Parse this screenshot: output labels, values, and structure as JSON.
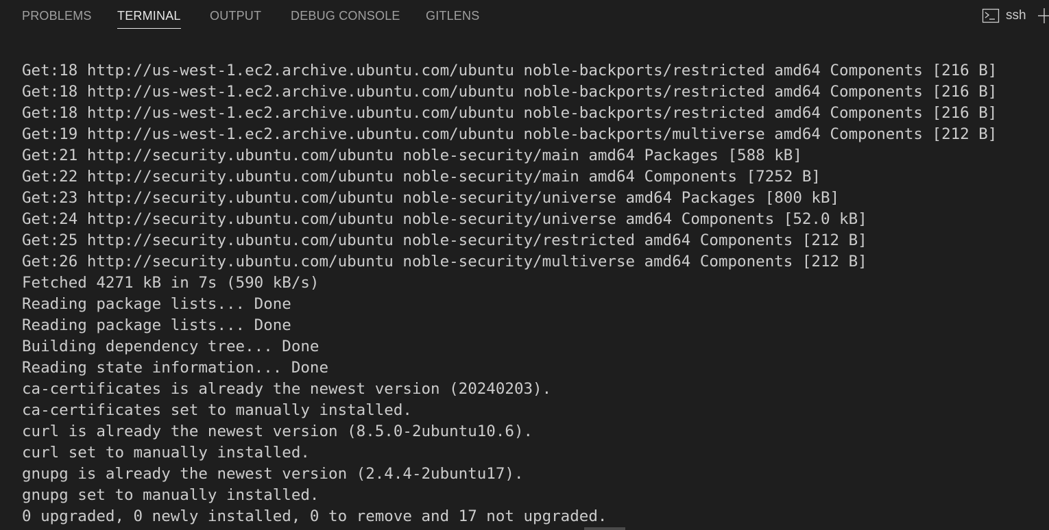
{
  "tabs": [
    {
      "label": "PROBLEMS",
      "active": false
    },
    {
      "label": "TERMINAL",
      "active": true
    },
    {
      "label": "OUTPUT",
      "active": false
    },
    {
      "label": "DEBUG CONSOLE",
      "active": false
    },
    {
      "label": "GITLENS",
      "active": false
    }
  ],
  "terminal_selector": {
    "icon": "terminal-icon",
    "label": "ssh"
  },
  "add_terminal": {
    "icon": "plus-icon"
  },
  "colors": {
    "background": "#1e1e1e",
    "text": "#cccccc",
    "active_tab": "#e7e7e7",
    "inactive_tab": "#a0a0a0"
  },
  "terminal": {
    "lines": [
      "Get:18 http://us-west-1.ec2.archive.ubuntu.com/ubuntu noble-backports/restricted amd64 Components [216 B]",
      "Get:18 http://us-west-1.ec2.archive.ubuntu.com/ubuntu noble-backports/restricted amd64 Components [216 B]",
      "Get:18 http://us-west-1.ec2.archive.ubuntu.com/ubuntu noble-backports/restricted amd64 Components [216 B]",
      "Get:19 http://us-west-1.ec2.archive.ubuntu.com/ubuntu noble-backports/multiverse amd64 Components [212 B]",
      "Get:21 http://security.ubuntu.com/ubuntu noble-security/main amd64 Packages [588 kB]",
      "Get:22 http://security.ubuntu.com/ubuntu noble-security/main amd64 Components [7252 B]",
      "Get:23 http://security.ubuntu.com/ubuntu noble-security/universe amd64 Packages [800 kB]",
      "Get:24 http://security.ubuntu.com/ubuntu noble-security/universe amd64 Components [52.0 kB]",
      "Get:25 http://security.ubuntu.com/ubuntu noble-security/restricted amd64 Components [212 B]",
      "Get:26 http://security.ubuntu.com/ubuntu noble-security/multiverse amd64 Components [212 B]",
      "Fetched 4271 kB in 7s (590 kB/s)",
      "Reading package lists... Done",
      "Reading package lists... Done",
      "Building dependency tree... Done",
      "Reading state information... Done",
      "ca-certificates is already the newest version (20240203).",
      "ca-certificates set to manually installed.",
      "curl is already the newest version (8.5.0-2ubuntu10.6).",
      "curl set to manually installed.",
      "gnupg is already the newest version (2.4.4-2ubuntu17).",
      "gnupg set to manually installed.",
      "0 upgraded, 0 newly installed, 0 to remove and 17 not upgraded."
    ]
  }
}
